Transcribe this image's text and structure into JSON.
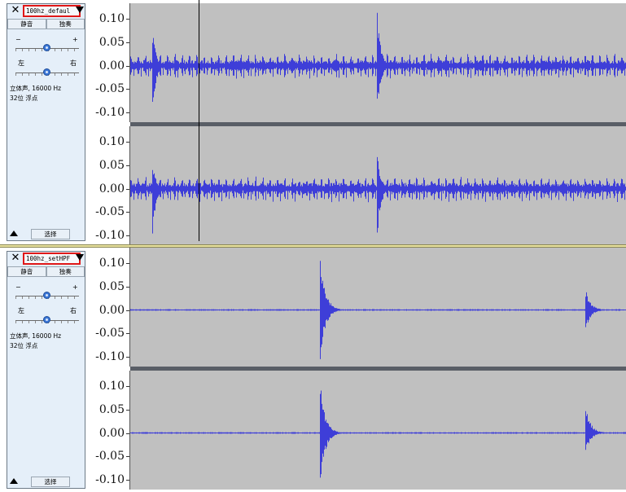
{
  "app": "Audacity",
  "axis_ticks": [
    "0.10",
    "0.05",
    "0.00",
    "-0.05",
    "-0.10"
  ],
  "waveform_color": "#3e3ed8",
  "background_color": "#c0c0c0",
  "tracks": [
    {
      "name": "100hz_defaul",
      "mute_label": "静音",
      "solo_label": "独奏",
      "gain_minus": "−",
      "gain_plus": "+",
      "pan_left": "左",
      "pan_right": "右",
      "info_line1": "立体声, 16000 Hz",
      "info_line2": "32位 浮点",
      "select_label": "选择",
      "channels": [
        {
          "kind": "dense",
          "spikes": [
            {
              "t": 0.045,
              "up": 0.08,
              "down": -0.11
            },
            {
              "t": 0.498,
              "up": 0.125,
              "down": -0.11
            }
          ]
        },
        {
          "kind": "dense",
          "spikes": [
            {
              "t": 0.045,
              "up": 0.06,
              "down": -0.11
            },
            {
              "t": 0.498,
              "up": 0.08,
              "down": -0.11
            }
          ]
        }
      ]
    },
    {
      "name": "100hz_setHPF",
      "mute_label": "静音",
      "solo_label": "独奏",
      "gain_minus": "−",
      "gain_plus": "+",
      "pan_left": "左",
      "pan_right": "右",
      "info_line1": "立体声, 16000 Hz",
      "info_line2": "32位 浮点",
      "select_label": "选择",
      "channels": [
        {
          "kind": "clean",
          "spikes": [
            {
              "t": 0.382,
              "up": 0.125,
              "down": -0.115
            },
            {
              "t": 0.918,
              "up": 0.045,
              "down": -0.045
            }
          ]
        },
        {
          "kind": "clean",
          "spikes": [
            {
              "t": 0.382,
              "up": 0.11,
              "down": -0.115
            },
            {
              "t": 0.918,
              "up": 0.06,
              "down": -0.045
            }
          ]
        }
      ]
    }
  ]
}
